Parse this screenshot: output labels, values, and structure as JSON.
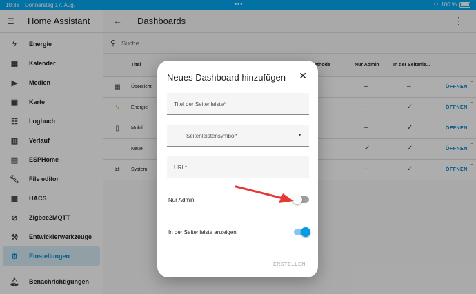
{
  "status_bar": {
    "time": "10:38",
    "date": "Donnerstag 17. Aug.",
    "battery": "100 %"
  },
  "sidebar": {
    "title": "Home Assistant",
    "items": [
      {
        "label": "Energie",
        "icon": "lightning-icon"
      },
      {
        "label": "Kalender",
        "icon": "calendar-icon"
      },
      {
        "label": "Medien",
        "icon": "media-icon"
      },
      {
        "label": "Karte",
        "icon": "map-icon"
      },
      {
        "label": "Logbuch",
        "icon": "logbook-icon"
      },
      {
        "label": "Verlauf",
        "icon": "history-icon"
      },
      {
        "label": "ESPHome",
        "icon": "esphome-icon"
      },
      {
        "label": "File editor",
        "icon": "wrench-icon"
      },
      {
        "label": "HACS",
        "icon": "hacs-icon"
      },
      {
        "label": "Zigbee2MQTT",
        "icon": "zigbee-icon"
      },
      {
        "label": "Entwicklerwerkzeuge",
        "icon": "hammer-icon"
      },
      {
        "label": "Einstellungen",
        "icon": "gear-icon",
        "active": true
      }
    ],
    "bottom_item": {
      "label": "Benachrichtigungen",
      "icon": "bell-icon"
    }
  },
  "header": {
    "title": "Dashboards"
  },
  "search": {
    "placeholder": "Suche"
  },
  "table": {
    "columns": {
      "title": "Titel",
      "mode": "Methode",
      "admin": "Nur Admin",
      "sidebar": "In der Seitenle..."
    },
    "rows": [
      {
        "title": "Übersicht",
        "icon": "dashboard-icon",
        "admin": "–",
        "sidebar": "–",
        "open": "ÖFFNEN"
      },
      {
        "title": "Energie",
        "icon": "lightning-icon",
        "admin": "–",
        "sidebar": "✓",
        "open": "ÖFFNEN"
      },
      {
        "title": "Mobil",
        "icon": "phone-icon",
        "admin": "–",
        "sidebar": "✓",
        "open": "ÖFFNEN"
      },
      {
        "title": "Neue",
        "icon": "",
        "admin": "✓",
        "sidebar": "✓",
        "open": "ÖFFNEN"
      },
      {
        "title": "System",
        "icon": "system-icon",
        "admin": "–",
        "sidebar": "✓",
        "open": "ÖFFNEN"
      }
    ]
  },
  "dialog": {
    "title": "Neues Dashboard hinzufügen",
    "fields": {
      "sidebar_title": "Titel der Seitenleiste*",
      "sidebar_icon": "Seitenleistensymbol*",
      "url": "URL*"
    },
    "toggles": {
      "admin_only": {
        "label": "Nur Admin",
        "on": false
      },
      "show_in_sidebar": {
        "label": "In der Seitenleiste anzeigen",
        "on": true
      }
    },
    "create_label": "ERSTELLEN"
  },
  "colors": {
    "accent": "#03a9f4",
    "link": "#0288d1",
    "annotation_arrow": "#e53935"
  }
}
